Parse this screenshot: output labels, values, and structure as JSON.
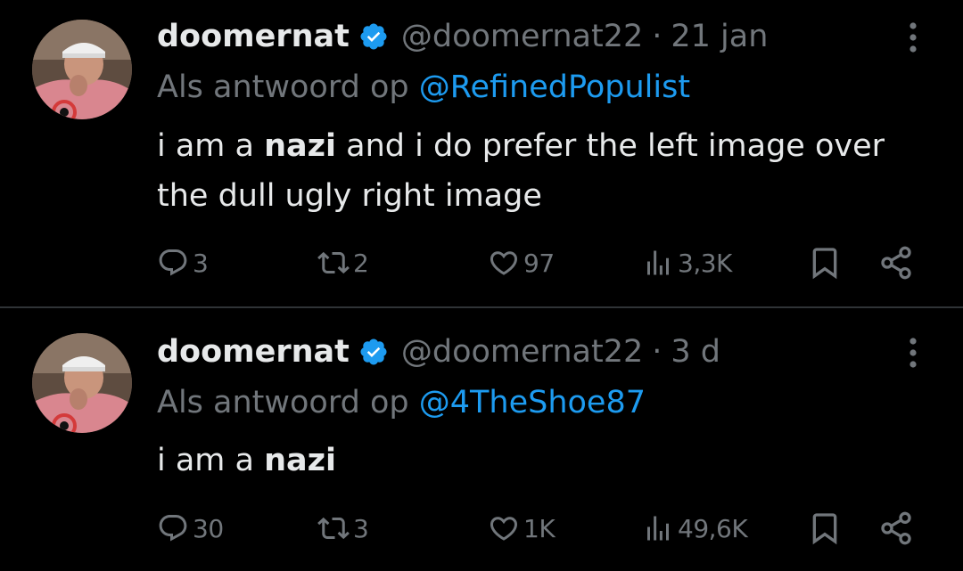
{
  "colors": {
    "background": "#000000",
    "text": "#e7e9ea",
    "muted": "#71767b",
    "accent": "#1d9bf0",
    "divider": "#2f3336"
  },
  "tweets": [
    {
      "display_name": "doomernat",
      "handle": "@doomernat22",
      "separator": "·",
      "time": "21 jan",
      "reply_prefix": "Als antwoord op",
      "reply_to": "@RefinedPopulist",
      "text_before": "i am a ",
      "text_bold": "nazi",
      "text_after": " and i do prefer the left image over the dull ugly right image",
      "replies": "3",
      "retweets": "2",
      "likes": "97",
      "views": "3,3K",
      "icons": {
        "verified": "verified-badge-icon",
        "more": "more-options-icon",
        "reply": "reply-icon",
        "retweet": "retweet-icon",
        "like": "heart-icon",
        "views": "views-icon",
        "bookmark": "bookmark-icon",
        "share": "share-icon"
      }
    },
    {
      "display_name": "doomernat",
      "handle": "@doomernat22",
      "separator": "·",
      "time": "3 d",
      "reply_prefix": "Als antwoord op",
      "reply_to": "@4TheShoe87",
      "text_before": "i am a ",
      "text_bold": "nazi",
      "text_after": "",
      "replies": "30",
      "retweets": "3",
      "likes": "1K",
      "views": "49,6K",
      "icons": {
        "verified": "verified-badge-icon",
        "more": "more-options-icon",
        "reply": "reply-icon",
        "retweet": "retweet-icon",
        "like": "heart-icon",
        "views": "views-icon",
        "bookmark": "bookmark-icon",
        "share": "share-icon"
      }
    }
  ]
}
